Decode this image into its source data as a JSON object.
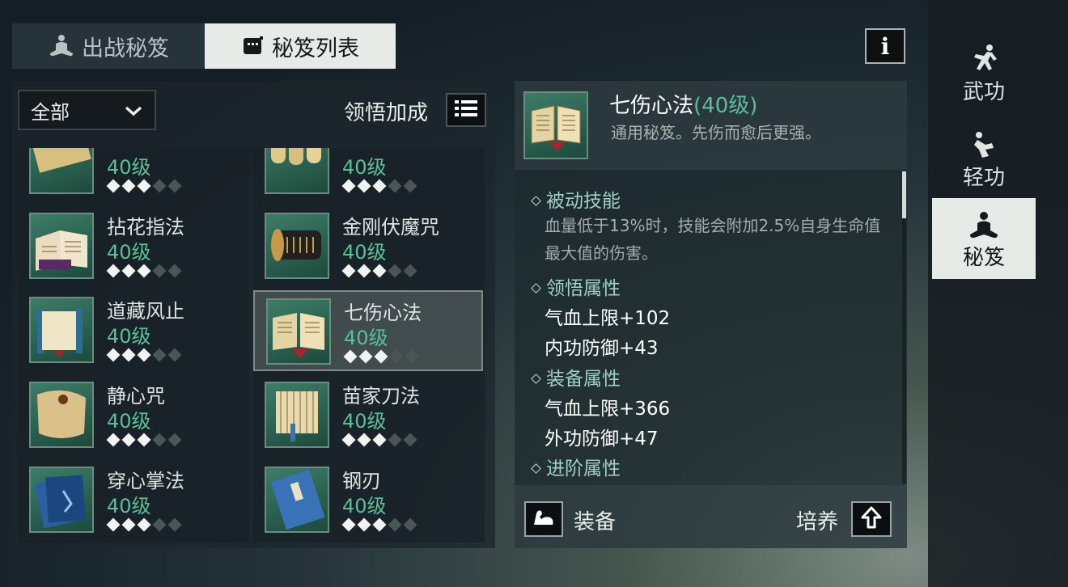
{
  "tabs": {
    "deploy_label": "出战秘笈",
    "list_label": "秘笈列表"
  },
  "info_label": "i",
  "filter": {
    "selected": "全部",
    "bonus_label": "领悟加成"
  },
  "items": [
    {
      "name": "",
      "level": "40级",
      "stars": 3,
      "max_stars": 5
    },
    {
      "name": "",
      "level": "40级",
      "stars": 3,
      "max_stars": 5
    },
    {
      "name": "拈花指法",
      "level": "40级",
      "stars": 3,
      "max_stars": 5
    },
    {
      "name": "金刚伏魔咒",
      "level": "40级",
      "stars": 3,
      "max_stars": 5
    },
    {
      "name": "道藏风止",
      "level": "40级",
      "stars": 3,
      "max_stars": 5
    },
    {
      "name": "七伤心法",
      "level": "40级",
      "stars": 3,
      "max_stars": 5,
      "selected": true
    },
    {
      "name": "静心咒",
      "level": "40级",
      "stars": 3,
      "max_stars": 5
    },
    {
      "name": "苗家刀法",
      "level": "40级",
      "stars": 3,
      "max_stars": 5
    },
    {
      "name": "穿心掌法",
      "level": "40级",
      "stars": 3,
      "max_stars": 5
    },
    {
      "name": "钢刃",
      "level": "40级",
      "stars": 3,
      "max_stars": 5
    }
  ],
  "detail": {
    "name": "七伤心法",
    "level": "(40级)",
    "subtitle": "通用秘笈。先伤而愈后更强。",
    "sections": {
      "passive_title": "被动技能",
      "passive_desc": "血量低于13%时，技能会附加2.5%自身生命值最大值的伤害。",
      "comprehend_title": "领悟属性",
      "comprehend_attrs": [
        "气血上限+102",
        "内功防御+43"
      ],
      "equip_title": "装备属性",
      "equip_attrs": [
        "气血上限+366",
        "外功防御+47"
      ],
      "advance_title": "进阶属性"
    },
    "equip_label": "装备",
    "train_label": "培养"
  },
  "sidebar": {
    "martial_label": "武功",
    "lightness_label": "轻功",
    "manual_label": "秘笈"
  },
  "colors": {
    "level_green": "#59c09a",
    "section_teal": "#9fd0c3",
    "tab_active_bg": "#e6ebe8"
  }
}
